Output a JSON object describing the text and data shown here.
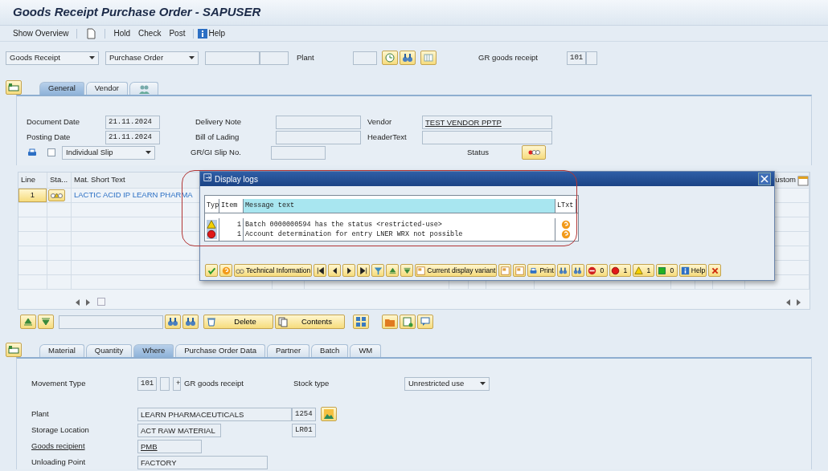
{
  "window": {
    "title": "Goods Receipt Purchase Order - SAPUSER"
  },
  "toolbar": [
    {
      "kind": "text",
      "label": "Show Overview"
    },
    {
      "kind": "icon"
    },
    {
      "kind": "text",
      "label": "Hold"
    },
    {
      "kind": "text",
      "label": "Check"
    },
    {
      "kind": "text",
      "label": "Post"
    },
    {
      "kind": "help",
      "label": "Help"
    }
  ],
  "selection": {
    "transaction": "Goods Receipt",
    "reference": "Purchase Order",
    "plant_label": "Plant",
    "movement_text": "GR goods receipt",
    "movement_type": "101"
  },
  "header_tabs": [
    {
      "kind": "text",
      "label": "General",
      "selected": true
    },
    {
      "kind": "text",
      "label": "Vendor",
      "selected": false
    },
    {
      "kind": "icon",
      "selected": false
    }
  ],
  "general": {
    "document_date": {
      "label": "Document Date",
      "value": "21.11.2024"
    },
    "posting_date": {
      "label": "Posting Date",
      "value": "21.11.2024"
    },
    "slip": {
      "checked": false,
      "value": "Individual Slip"
    },
    "delivery_note": {
      "label": "Delivery Note"
    },
    "bill_of_lading": {
      "label": "Bill of Lading"
    },
    "slip_no": {
      "label": "GR/GI Slip No."
    },
    "vendor": {
      "label": "Vendor",
      "value": "TEST VENDOR PPTP"
    },
    "header_text": {
      "label": "HeaderText"
    },
    "status": {
      "label": "Status"
    }
  },
  "items_table": {
    "columns": [
      "Line",
      "Sta...",
      "Mat. Short Text"
    ],
    "last_column": "ustom",
    "rows": [
      {
        "line": "1",
        "material": "LACTIC ACID IP LEARN PHARMA"
      }
    ]
  },
  "item_buttons": {
    "delete": "Delete",
    "contents": "Contents"
  },
  "item_tabs": [
    {
      "label": "Material",
      "selected": false
    },
    {
      "label": "Quantity",
      "selected": false
    },
    {
      "label": "Where",
      "selected": true
    },
    {
      "label": "Purchase Order Data",
      "selected": false
    },
    {
      "label": "Partner",
      "selected": false
    },
    {
      "label": "Batch",
      "selected": false
    },
    {
      "label": "WM",
      "selected": false
    }
  ],
  "where": {
    "movement_type": {
      "label": "Movement Type",
      "value": "101",
      "sign": "+",
      "text": "GR goods receipt"
    },
    "stock_type": {
      "label": "Stock type",
      "value": "Unrestricted use"
    },
    "plant": {
      "label": "Plant",
      "name": "LEARN PHARMACEUTICALS",
      "code": "1254"
    },
    "storage_location": {
      "label": "Storage Location",
      "name": "ACT RAW MATERIAL",
      "code": "LR01"
    },
    "goods_recipient": {
      "label": "Goods recipient",
      "value": "PMB"
    },
    "unloading_point": {
      "label": "Unloading Point",
      "value": "FACTORY"
    }
  },
  "dialog": {
    "title": "Display logs",
    "columns": [
      "Typ",
      "Item",
      "Message text",
      "LTxt"
    ],
    "rows": [
      {
        "kind": "warning",
        "item": "1",
        "text": "Batch 0000000594 has the status <restricted-use>"
      },
      {
        "kind": "error",
        "item": "1",
        "text": "Account determination for entry LNER WRX not possible"
      }
    ],
    "buttons": {
      "technical": "Technical Information",
      "variant": "Current display variant",
      "print": "Print",
      "help": "Help"
    },
    "counters": [
      {
        "kind": "stop",
        "count": "0"
      },
      {
        "kind": "error",
        "count": "1"
      },
      {
        "kind": "warning",
        "count": "1"
      },
      {
        "kind": "success",
        "count": "0"
      }
    ]
  },
  "annotation": {
    "kind": "outline"
  }
}
